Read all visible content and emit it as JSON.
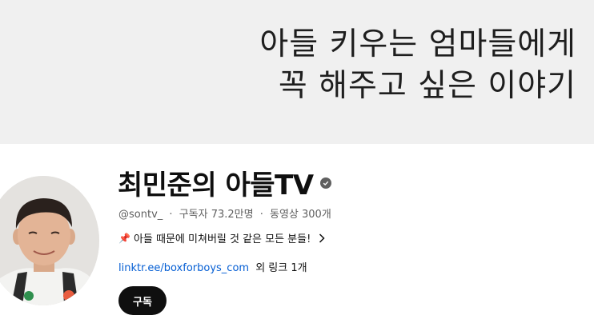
{
  "banner": {
    "line1": "아들 키우는 엄마들에게",
    "line2": "꼭 해주고 싶은 이야기"
  },
  "channel": {
    "name": "최민준의 아들TV",
    "verified_icon": "verified-check-icon",
    "handle": "@sontv_",
    "separator": "·",
    "subscribers": "구독자 73.2만명",
    "videos": "동영상 300개",
    "description": "아들 때문에 미쳐버릴 것 같은 모든 분들!",
    "pin_icon": "pushpin-icon",
    "link_text": "linktr.ee/boxforboys_com",
    "more_links": "외 링크 1개"
  },
  "actions": {
    "subscribe_label": "구독"
  },
  "colors": {
    "banner_bg": "#f0f0f0",
    "subscribe_bg": "#0f0f0f",
    "link": "#065fd4",
    "secondary_text": "#606060"
  }
}
